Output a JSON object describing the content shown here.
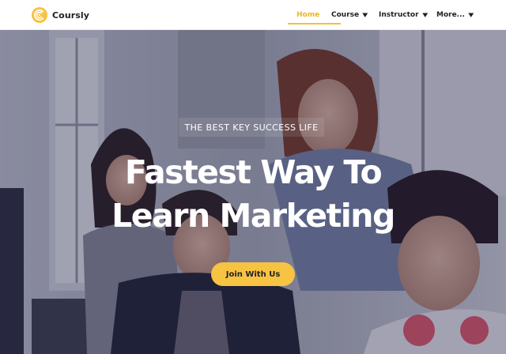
{
  "brand": {
    "name": "Coursly",
    "logo_icon": "coursly-logo-icon",
    "accent_color": "#f6c343"
  },
  "nav": {
    "items": [
      {
        "label": "Home",
        "active": true,
        "has_dropdown": false
      },
      {
        "label": "Course",
        "active": false,
        "has_dropdown": true,
        "icon": "chevron-down-icon"
      },
      {
        "label": "Instructor",
        "active": false,
        "has_dropdown": true,
        "icon": "chevron-down-icon"
      },
      {
        "label": "More...",
        "active": false,
        "has_dropdown": true,
        "icon": "chevron-down-icon"
      }
    ]
  },
  "hero": {
    "eyebrow": "THE BEST KEY SUCCESS LIFE",
    "headline_line1": "Fastest Way To",
    "headline_line2": "Learn Marketing",
    "cta_label": "Join With Us"
  }
}
